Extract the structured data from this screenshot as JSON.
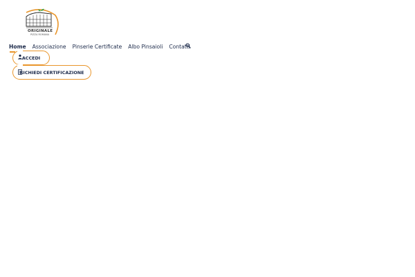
{
  "logo": {
    "line1": "ORIGINALE",
    "line2": "PIZZA ROMANA",
    "icon": "colosseum-logo-icon",
    "accent_color": "#e9952a",
    "leaf_color": "#3aa64a"
  },
  "nav": {
    "items": [
      {
        "label": "Home",
        "active": true
      },
      {
        "label": "Associazione"
      },
      {
        "label": "Pinserie Certificate"
      },
      {
        "label": "Albo Pinsaioli"
      },
      {
        "label": "Contatti"
      }
    ],
    "search_icon": "search-icon"
  },
  "buttons": {
    "accedi": {
      "label": "ACCEDI",
      "icon": "user-icon"
    },
    "certificazione": {
      "label": "RICHIEDI CERTIFICAZIONE",
      "icon": "document-icon"
    }
  },
  "colors": {
    "text": "#1c2a4a",
    "accent": "#e9952a",
    "background": "#ffffff"
  }
}
